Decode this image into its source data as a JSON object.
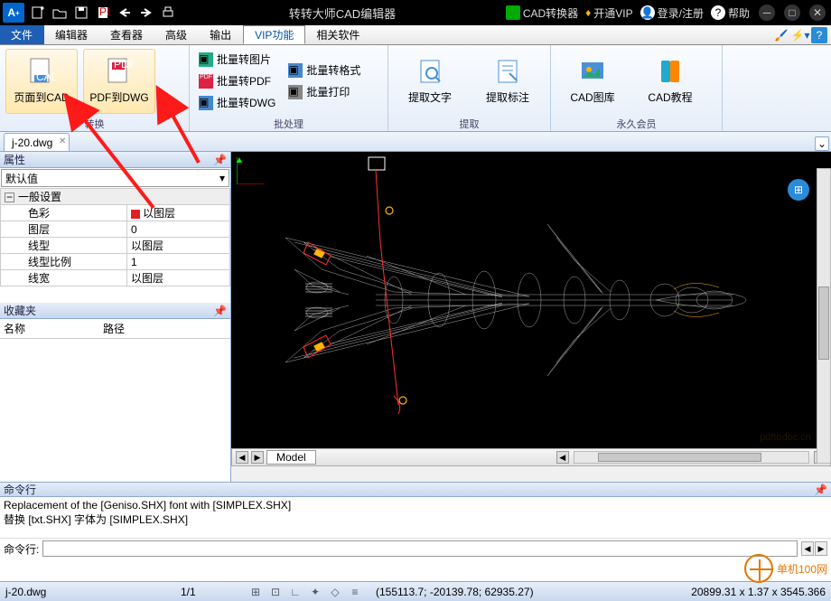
{
  "titlebar": {
    "title": "转转大师CAD编辑器",
    "converter": "CAD转换器",
    "vip": "开通VIP",
    "login": "登录/注册",
    "help": "帮助"
  },
  "menu": {
    "file": "文件",
    "editor": "编辑器",
    "viewer": "查看器",
    "advanced": "高级",
    "output": "输出",
    "vip": "VIP功能",
    "related": "相关软件"
  },
  "ribbon": {
    "convert": {
      "label": "转换",
      "page_to_cad": "页面到CAD",
      "pdf_to_dwg": "PDF到DWG"
    },
    "batch": {
      "label": "批处理",
      "batch_image": "批量转图片",
      "batch_pdf": "批量转PDF",
      "batch_dwg": "批量转DWG",
      "batch_format": "批量转格式",
      "batch_print": "批量打印"
    },
    "extract": {
      "label": "提取",
      "extract_text": "提取文字",
      "extract_anno": "提取标注"
    },
    "member": {
      "label": "永久会员",
      "gallery": "CAD图库",
      "tutorial": "CAD教程"
    }
  },
  "filetab": {
    "name": "j-20.dwg"
  },
  "props": {
    "title": "属性",
    "default": "默认值",
    "general": "一般设置",
    "rows": [
      {
        "k": "色彩",
        "v": "以图层",
        "sw": true
      },
      {
        "k": "图层",
        "v": "0"
      },
      {
        "k": "线型",
        "v": "以图层"
      },
      {
        "k": "线型比例",
        "v": "1"
      },
      {
        "k": "线宽",
        "v": "以图层"
      }
    ]
  },
  "fav": {
    "title": "收藏夹",
    "col1": "名称",
    "col2": "路径"
  },
  "model_tab": "Model",
  "cmd": {
    "title": "命令行",
    "log1": "Replacement of the [Geniso.SHX] font with [SIMPLEX.SHX]",
    "log2": "替换 [txt.SHX] 字体为 [SIMPLEX.SHX]",
    "prompt": "命令行:"
  },
  "status": {
    "file": "j-20.dwg",
    "page": "1/1",
    "coords": "(155113.7; -20139.78; 62935.27)",
    "dims": "20899.31 x 1.37 x 3545.366"
  },
  "footer_wm": "单机100网"
}
